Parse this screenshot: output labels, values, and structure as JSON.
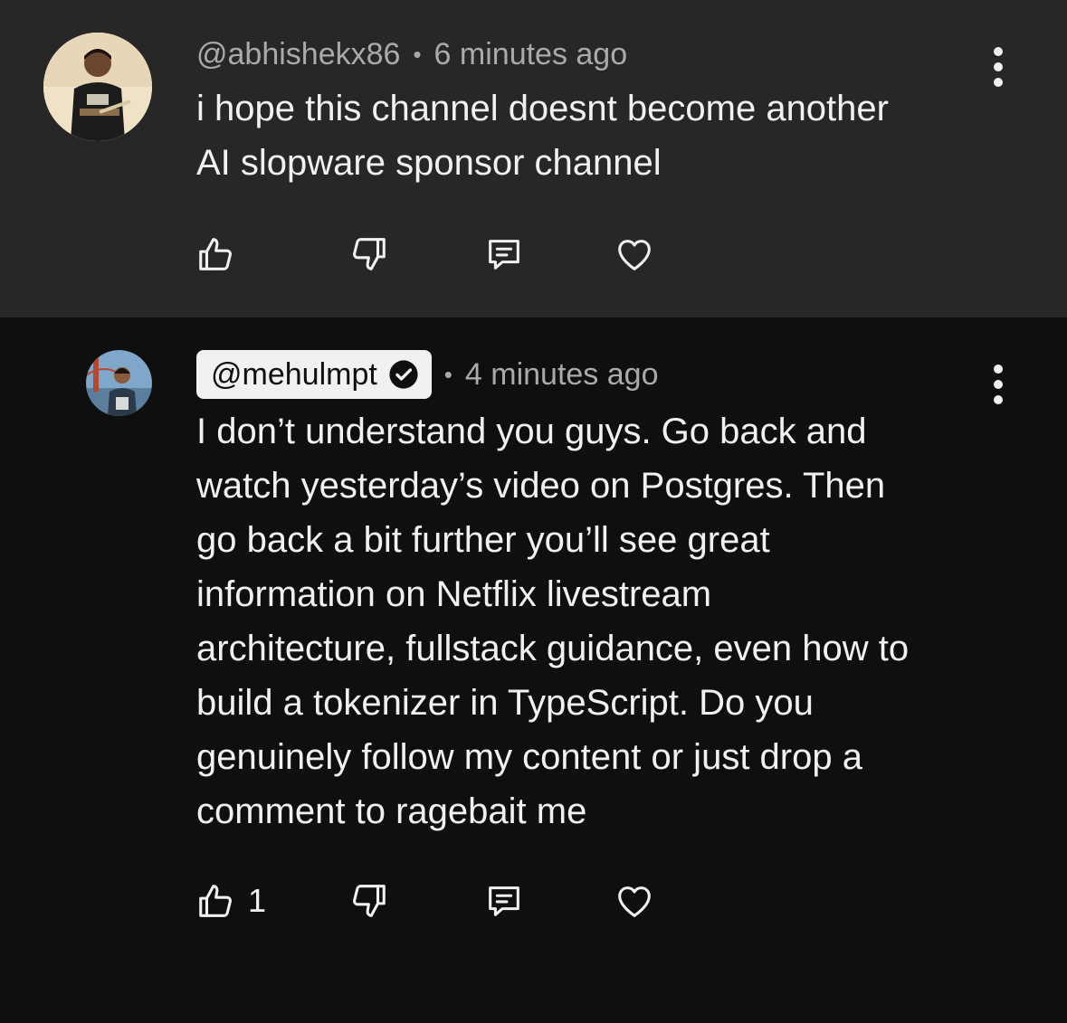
{
  "comments": [
    {
      "handle": "@abhishekx86",
      "separator": "•",
      "time": "6 minutes ago",
      "text": "i hope this channel doesnt become another\nAI slopware sponsor channel",
      "like_count": ""
    },
    {
      "handle": "@mehulmpt",
      "verified": true,
      "separator": "•",
      "time": "4 minutes ago",
      "text": "I don’t understand you guys. Go back and\nwatch yesterday’s video on Postgres. Then\ngo back a bit further you’ll see great\ninformation on Netflix livestream\narchitecture, fullstack guidance, even how to\nbuild a tokenizer in TypeScript. Do you\ngenuinely follow my content or just drop a\ncomment to ragebait me",
      "like_count": "1"
    }
  ],
  "icons": {
    "like": "thumbs-up-icon",
    "dislike": "thumbs-down-icon",
    "reply": "reply-icon",
    "heart": "heart-icon",
    "more": "more-vert-icon",
    "verified": "verified-check-icon"
  },
  "colors": {
    "top_bg": "#272727",
    "bottom_bg": "#0f0f0f",
    "text": "#f1f1f1",
    "meta": "#aaaaaa"
  }
}
